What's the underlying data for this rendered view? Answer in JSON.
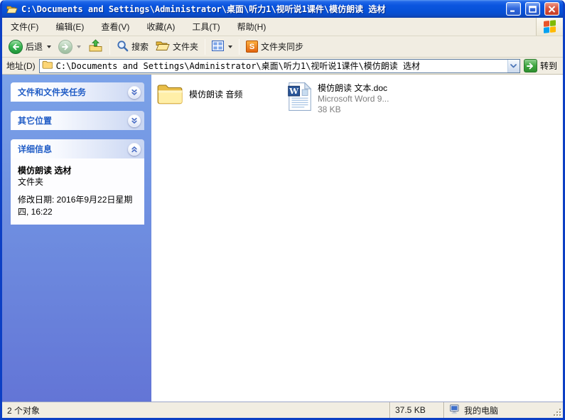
{
  "window": {
    "title": "C:\\Documents and Settings\\Administrator\\桌面\\听力1\\视听说1课件\\模仿朗读 选材"
  },
  "menu": {
    "items": [
      {
        "label": "文件(F)"
      },
      {
        "label": "编辑(E)"
      },
      {
        "label": "查看(V)"
      },
      {
        "label": "收藏(A)"
      },
      {
        "label": "工具(T)"
      },
      {
        "label": "帮助(H)"
      }
    ]
  },
  "toolbar": {
    "back_label": "后退",
    "search_label": "搜索",
    "folders_label": "文件夹",
    "sync_label": "文件夹同步",
    "sync_badge": "S"
  },
  "address": {
    "label": "地址(D)",
    "value": "C:\\Documents and Settings\\Administrator\\桌面\\听力1\\视听说1课件\\模仿朗读 选材",
    "go_label": "转到"
  },
  "sidebar": {
    "panels": [
      {
        "title": "文件和文件夹任务",
        "state": "collapsed"
      },
      {
        "title": "其它位置",
        "state": "collapsed"
      },
      {
        "title": "详细信息",
        "state": "expanded"
      }
    ],
    "details": {
      "name": "模仿朗读 选材",
      "type": "文件夹",
      "modified": "修改日期: 2016年9月22日星期四, 16:22"
    }
  },
  "files": {
    "items": [
      {
        "name": "模仿朗读 音频",
        "kind": "folder"
      },
      {
        "name": "模仿朗读 文本.doc",
        "kind": "word-document",
        "meta1": "Microsoft Word 9...",
        "meta2": "38 KB"
      }
    ]
  },
  "statusbar": {
    "objects": "2 个对象",
    "size": "37.5 KB",
    "zone": "我的电脑"
  },
  "colors": {
    "titlebar_blue": "#0750D6",
    "window_border": "#0C3FC4",
    "chrome_beige": "#F1EDE2",
    "sidebar_top": "#7CA3E8",
    "sidebar_bottom": "#6375D6",
    "panel_title": "#215DC6",
    "folder_yellow": "#F6CE5C",
    "word_blue": "#2B579A",
    "go_green": "#3FA63F"
  }
}
